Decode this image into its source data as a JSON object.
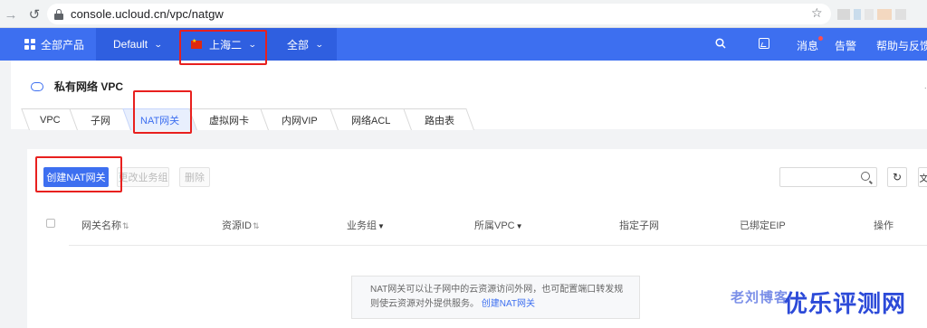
{
  "browser": {
    "back_icon": "arrow-left-icon",
    "refresh_icon": "refresh-icon",
    "url": "console.ucloud.cn/vpc/natgw",
    "star_icon": "star-icon"
  },
  "topnav": {
    "all_products": "全部产品",
    "project": "Default",
    "region": "上海二",
    "scope": "全部",
    "messages": "消息",
    "alarm": "告警",
    "help": "帮助与反馈",
    "accent_color": "#3d6ff0"
  },
  "page": {
    "title": "私有网络 VPC",
    "tabs": [
      "VPC",
      "子网",
      "NAT网关",
      "虚拟网卡",
      "内网VIP",
      "网络ACL",
      "路由表"
    ],
    "active_tab": "NAT网关"
  },
  "toolbar": {
    "create_label": "创建NAT网关",
    "change_group_label": "更改业务组",
    "delete_label": "删除",
    "search_placeholder": ""
  },
  "table": {
    "columns": [
      "网关名称",
      "资源ID",
      "业务组",
      "所属VPC",
      "指定子网",
      "已绑定EIP",
      "操作"
    ]
  },
  "empty": {
    "line1": "NAT网关可以让子网中的云资源访问外网，也可配置端口转发规",
    "line2_prefix": "则使云资源对外提供服务。",
    "line2_link": "创建NAT网关"
  },
  "watermark": {
    "small": "老刘博客",
    "large": "优乐评测网"
  }
}
